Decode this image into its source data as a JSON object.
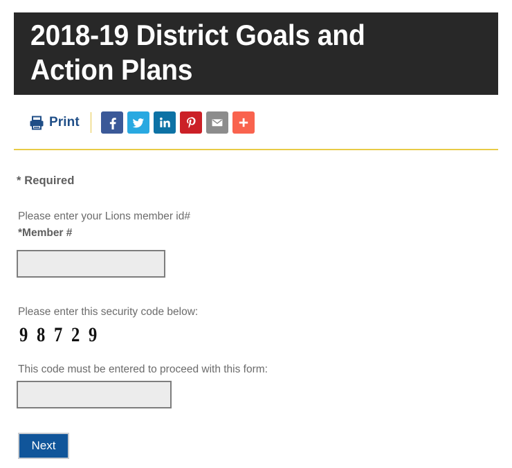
{
  "page": {
    "title": "2018-19 District Goals and Action Plans"
  },
  "toolbar": {
    "print_label": "Print",
    "print_icon": "printer-icon",
    "divider": "|",
    "share_buttons": [
      {
        "name": "facebook",
        "label": "f",
        "color": "#3b5998"
      },
      {
        "name": "twitter",
        "label": "",
        "color": "#29a9e1"
      },
      {
        "name": "linkedin",
        "label": "in",
        "color": "#0d72a5"
      },
      {
        "name": "pinterest",
        "label": "P",
        "color": "#cb2027"
      },
      {
        "name": "email",
        "label": "",
        "color": "#8c8c8c"
      },
      {
        "name": "more",
        "label": "+",
        "color": "#f9634e"
      }
    ]
  },
  "divider": {
    "color": "#e8cb46"
  },
  "form": {
    "required_note": "* Required",
    "member": {
      "hint": "Please enter your Lions member id#",
      "label": "*Member #",
      "value": "",
      "placeholder": ""
    },
    "captcha": {
      "prompt": "Please enter this security code below:",
      "code": "9 8 7 2 9"
    },
    "code_entry": {
      "prompt": "This code must be entered to proceed with this form:",
      "value": "",
      "placeholder": ""
    },
    "submit_label": "Next"
  },
  "colors": {
    "banner_background": "#282828",
    "accent_gold": "#e8cb46",
    "button_blue": "#10559a",
    "print_blue": "#1f4e87",
    "input_fill": "#ececec",
    "input_border": "#7d7d7d"
  }
}
